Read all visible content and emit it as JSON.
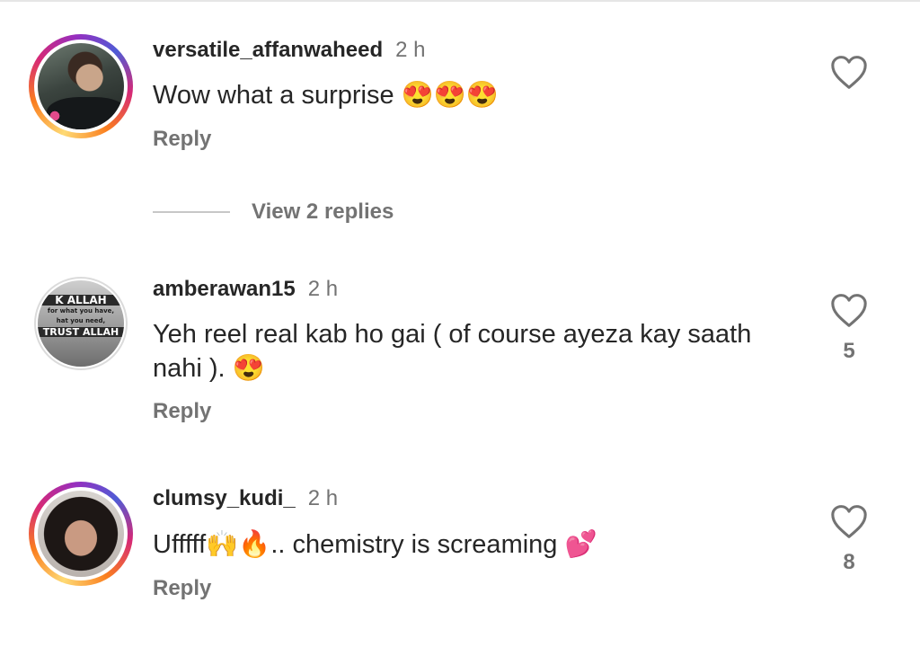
{
  "comments": [
    {
      "username": "versatile_affanwaheed",
      "time": "2 h",
      "text": "Wow what a surprise 😍😍😍",
      "reply_label": "Reply",
      "like_count": ""
    },
    {
      "username": "amberawan15",
      "time": "2 h",
      "text": "Yeh reel real kab ho gai ( of course ayeza kay saath nahi ). 😍",
      "reply_label": "Reply",
      "like_count": "5",
      "avatar_text": [
        "K ALLAH",
        "for what you have,",
        "hat you need,",
        "TRUST ALLAH"
      ]
    },
    {
      "username": "clumsy_kudi_",
      "time": "2 h",
      "text": "Ufffff🙌🔥.. chemistry is screaming 💕",
      "reply_label": "Reply",
      "like_count": "8"
    }
  ],
  "view_replies": {
    "label": "View 2 replies"
  },
  "icons": {
    "like": "heart-outline-icon"
  },
  "colors": {
    "text": "#262626",
    "secondary": "#737373",
    "ring_start": "#feda75",
    "ring_end": "#962fbf"
  }
}
